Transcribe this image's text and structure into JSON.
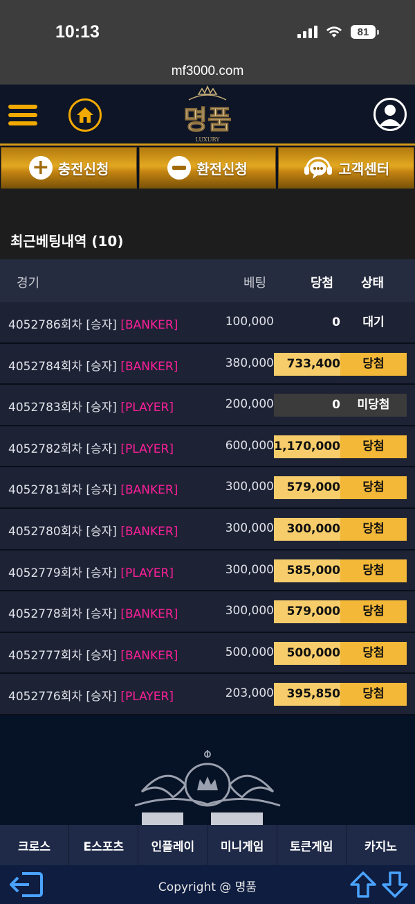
{
  "status": {
    "time": "10:13",
    "battery": "81"
  },
  "browser": {
    "url": "mf3000.com"
  },
  "header": {
    "logo_text": "명품",
    "logo_sub": "LUXURY"
  },
  "actions": [
    {
      "label": "충전신청",
      "icon": "plus-circle-icon"
    },
    {
      "label": "환전신청",
      "icon": "minus-circle-icon"
    },
    {
      "label": "고객센터",
      "icon": "chat-support-icon"
    }
  ],
  "section": {
    "title": "최근베팅내역 (10)"
  },
  "table": {
    "headers": {
      "game": "경기",
      "bet": "베팅",
      "win": "당첨",
      "state": "상태"
    },
    "rows": [
      {
        "round": "4052786회차 [승자]",
        "pick": "[BANKER]",
        "bet": "100,000",
        "win": "0",
        "state": "대기",
        "status": "wait"
      },
      {
        "round": "4052784회차 [승자]",
        "pick": "[BANKER]",
        "bet": "380,000",
        "win": "733,400",
        "state": "당첨",
        "status": "won"
      },
      {
        "round": "4052783회차 [승자]",
        "pick": "[PLAYER]",
        "bet": "200,000",
        "win": "0",
        "state": "미당첨",
        "status": "lost"
      },
      {
        "round": "4052782회차 [승자]",
        "pick": "[PLAYER]",
        "bet": "600,000",
        "win": "1,170,000",
        "state": "당첨",
        "status": "won"
      },
      {
        "round": "4052781회차 [승자]",
        "pick": "[BANKER]",
        "bet": "300,000",
        "win": "579,000",
        "state": "당첨",
        "status": "won"
      },
      {
        "round": "4052780회차 [승자]",
        "pick": "[BANKER]",
        "bet": "300,000",
        "win": "300,000",
        "state": "당첨",
        "status": "won"
      },
      {
        "round": "4052779회차 [승자]",
        "pick": "[PLAYER]",
        "bet": "300,000",
        "win": "585,000",
        "state": "당첨",
        "status": "won"
      },
      {
        "round": "4052778회차 [승자]",
        "pick": "[BANKER]",
        "bet": "300,000",
        "win": "579,000",
        "state": "당첨",
        "status": "won"
      },
      {
        "round": "4052777회차 [승자]",
        "pick": "[BANKER]",
        "bet": "500,000",
        "win": "500,000",
        "state": "당첨",
        "status": "won"
      },
      {
        "round": "4052776회차 [승자]",
        "pick": "[PLAYER]",
        "bet": "203,000",
        "win": "395,850",
        "state": "당첨",
        "status": "won"
      }
    ]
  },
  "bottom_nav": [
    {
      "label": "크로스"
    },
    {
      "label": "E스포츠"
    },
    {
      "label": "인플레이"
    },
    {
      "label": "미니게임"
    },
    {
      "label": "토큰게임"
    },
    {
      "label": "카지노"
    }
  ],
  "footer": {
    "copyright": "Copyright @ 명품"
  },
  "colors": {
    "accent_gold": "#f2a900",
    "pick_pink": "#ff1f9a",
    "won_bg": "#f6cd6a",
    "state_bg": "#f3b838"
  }
}
